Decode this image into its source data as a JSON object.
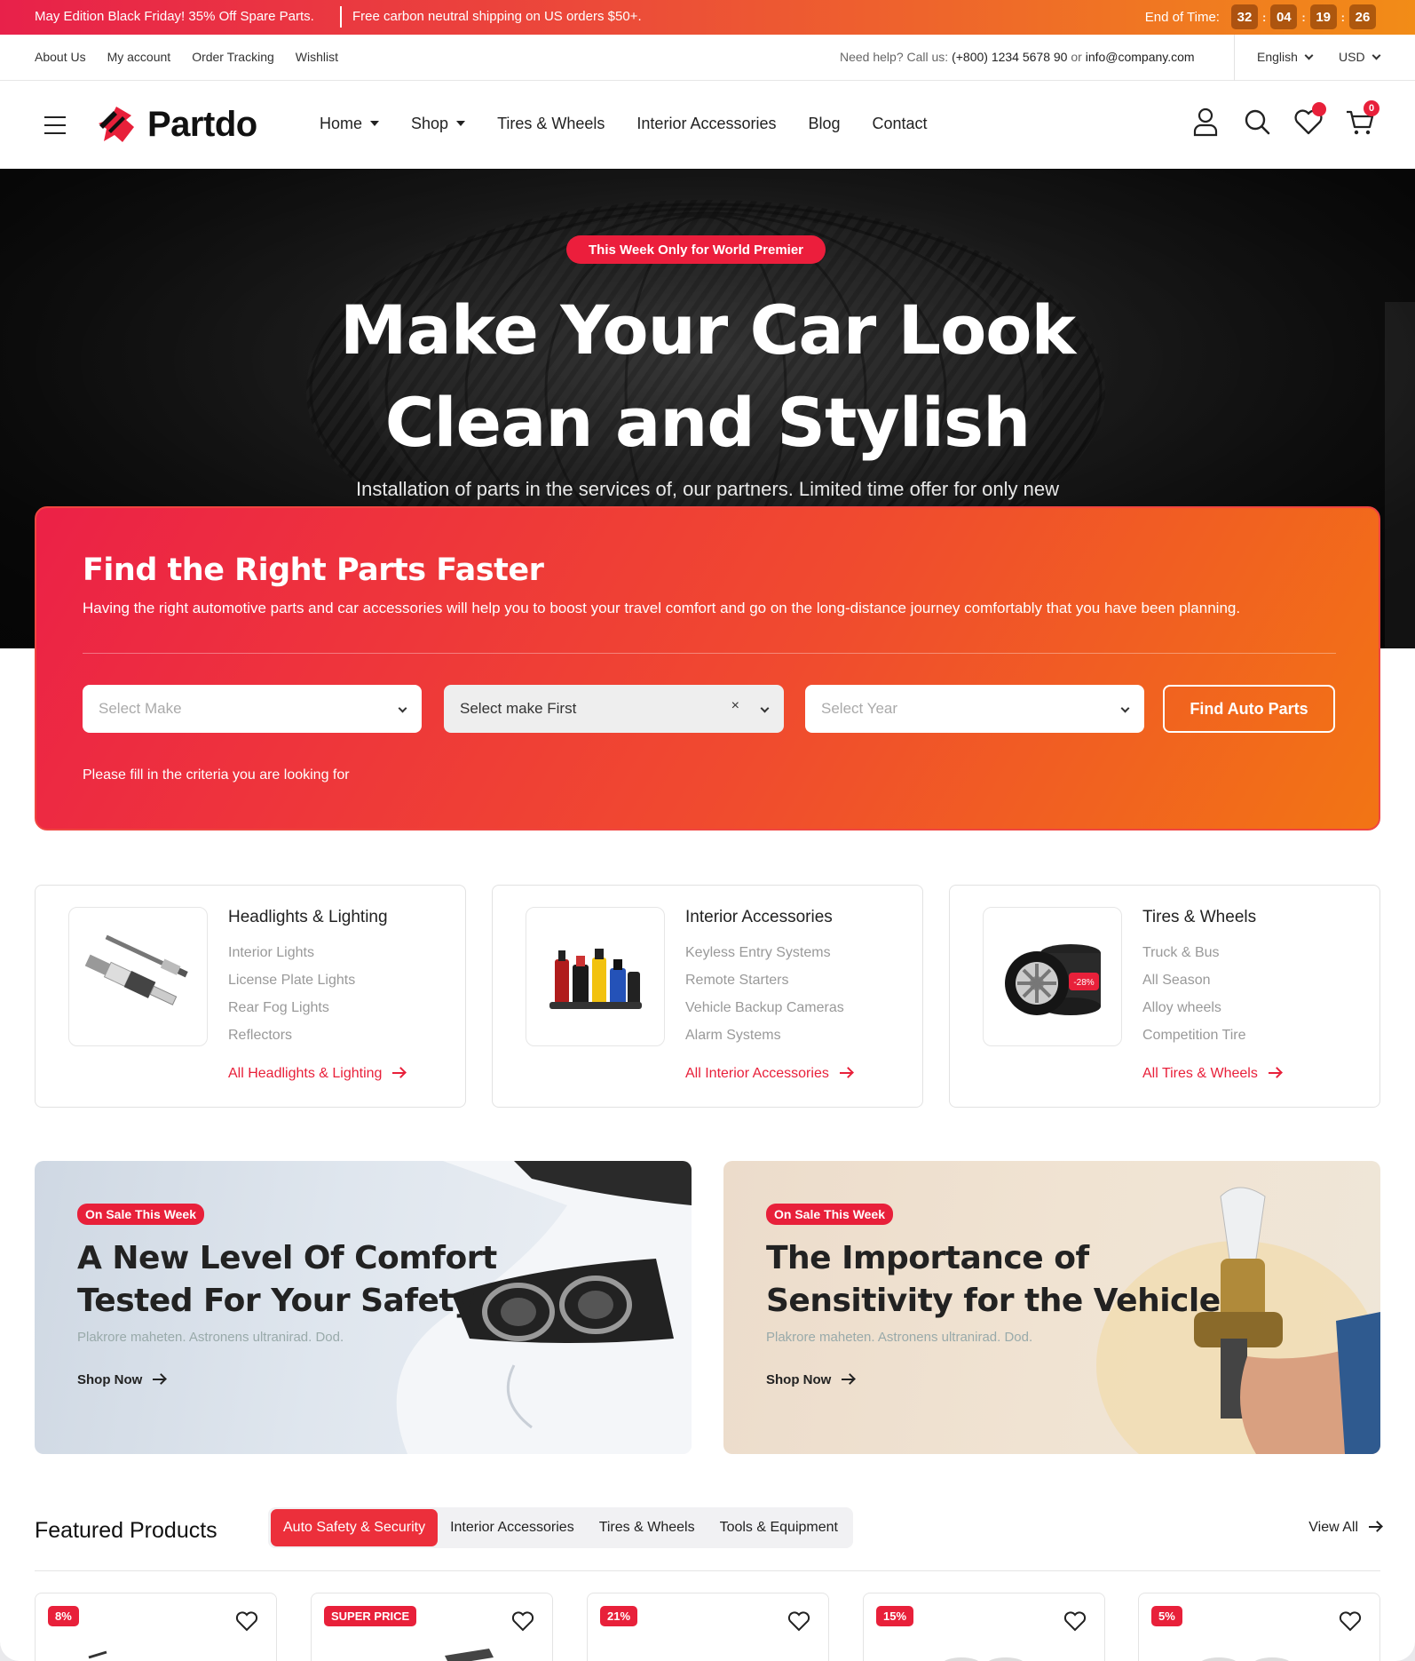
{
  "promo": {
    "left": "May Edition Black Friday! 35% Off Spare Parts.",
    "right": "Free carbon neutral shipping on US orders $50+.",
    "timer_label": "End of Time:",
    "timer": [
      "32",
      "04",
      "19",
      "26"
    ]
  },
  "topbar": {
    "links": [
      "About Us",
      "My account",
      "Order Tracking",
      "Wishlist"
    ],
    "help_prefix": "Need help? Call us:",
    "phone": "(+800) 1234 5678 90",
    "or": "or",
    "email": "info@company.com",
    "language": "English",
    "currency": "USD"
  },
  "header": {
    "logo": "Partdo",
    "nav": [
      "Home",
      "Shop",
      "Tires & Wheels",
      "Interior Accessories",
      "Blog",
      "Contact"
    ],
    "cart_count": "0"
  },
  "hero": {
    "badge": "This Week Only for World Premier",
    "title_line1": "Make Your Car Look",
    "title_line2": "Clean and Stylish",
    "subtitle": "Installation of parts in the services of, our partners. Limited time offer for only new"
  },
  "finder": {
    "title": "Find the Right Parts Faster",
    "description": "Having the right automotive parts and car accessories will help you to boost your travel comfort and go on the long-distance journey comfortably that you have been planning.",
    "select_make": "Select Make",
    "select_model": "Select make First",
    "select_year": "Select Year",
    "button": "Find Auto Parts",
    "hint": "Please fill in the criteria you are looking for"
  },
  "categories": [
    {
      "title": "Headlights & Lighting",
      "items": [
        "Interior Lights",
        "License Plate Lights",
        "Rear Fog Lights",
        "Reflectors"
      ],
      "all": "All Headlights & Lighting"
    },
    {
      "title": "Interior Accessories",
      "items": [
        "Keyless Entry Systems",
        "Remote Starters",
        "Vehicle Backup Cameras",
        "Alarm Systems"
      ],
      "all": "All Interior Accessories"
    },
    {
      "title": "Tires & Wheels",
      "items": [
        "Truck & Bus",
        "All Season",
        "Alloy wheels",
        "Competition Tire"
      ],
      "all": "All Tires & Wheels",
      "image_badge": "-28%"
    }
  ],
  "banners": [
    {
      "badge": "On Sale This Week",
      "title_line1": "A New Level Of Comfort",
      "title_line2": "Tested For Your Safety",
      "subtitle": "Plakrore maheten. Astronens ultranirad. Dod.",
      "link": "Shop Now"
    },
    {
      "badge": "On Sale This Week",
      "title_line1": "The Importance of",
      "title_line2": "Sensitivity for the Vehicle",
      "subtitle": "Plakrore maheten. Astronens ultranirad. Dod.",
      "link": "Shop Now"
    }
  ],
  "featured": {
    "title": "Featured Products",
    "tabs": [
      "Auto Safety & Security",
      "Interior Accessories",
      "Tires & Wheels",
      "Tools & Equipment"
    ],
    "view_all": "View All",
    "badges": [
      "8%",
      "SUPER PRICE",
      "21%",
      "15%",
      "5%"
    ]
  },
  "colors": {
    "accent": "#e8203a",
    "orange": "#f27514"
  }
}
